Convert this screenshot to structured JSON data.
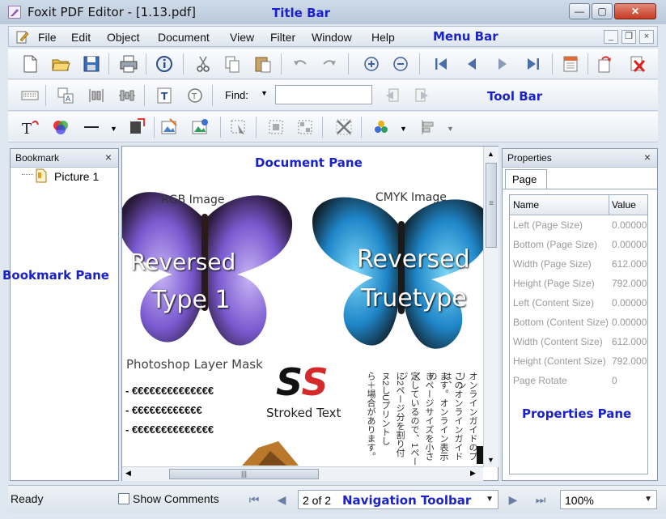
{
  "window": {
    "title": "Foxit PDF Editor - [1.13.pdf]",
    "minimize_glyph": "—",
    "maximize_glyph": "▢",
    "close_glyph": "✕"
  },
  "annotations": {
    "title_bar": "Title Bar",
    "menu_bar": "Menu Bar",
    "tool_bar": "Tool Bar",
    "document_pane": "Document Pane",
    "bookmark_pane": "Bookmark Pane",
    "properties_pane": "Properties Pane",
    "navigation_toolbar": "Navigation Toolbar"
  },
  "menu": {
    "items": [
      "File",
      "Edit",
      "Object",
      "Document",
      "View",
      "Filter",
      "Window",
      "Help"
    ],
    "mdi_minimize": "_",
    "mdi_restore": "❐",
    "mdi_close": "×"
  },
  "toolbar": {
    "find_label": "Find:",
    "find_value": "",
    "dropdown_arrow": "▼"
  },
  "bookmark_pane": {
    "title": "Bookmark",
    "close": "×",
    "items": [
      {
        "label": "Picture 1",
        "icon": "page-icon"
      }
    ]
  },
  "document": {
    "rgb_label": "RGB Image",
    "cmyk_label": "CMYK Image",
    "left_title_1": "Reversed",
    "left_title_2": "Type 1",
    "right_title_1": "Reversed",
    "right_title_2": "Truetype",
    "layer_mask": "Photoshop Layer Mask",
    "ss_text": "SS",
    "stroked_text": "Stroked Text",
    "euro_lines": [
      "- €€€€€€€€€€€€€€",
      "- €€€€€€€€€€€€",
      "- €€€€€€€€€€€€€€"
    ],
    "jp_columns": [
      "オンラインガイドのプリン",
      "このオンラインガイドは、",
      "ます。オンライン表示の",
      "きページサイズを小さく",
      "定しているので、1ページ",
      "に2ページ分を割り付",
      "ヌ2しUプリントし",
      "ら＋場合があります。"
    ],
    "hscroll_grip": "|||",
    "vscroll_grip": "≡"
  },
  "properties_pane": {
    "title": "Properties",
    "close": "×",
    "tab": "Page",
    "columns": [
      "Name",
      "Value"
    ],
    "rows": [
      {
        "name": "Left (Page Size)",
        "value": "0.00000"
      },
      {
        "name": "Bottom (Page Size)",
        "value": "0.00000"
      },
      {
        "name": "Width (Page Size)",
        "value": "612.000"
      },
      {
        "name": "Height (Page Size)",
        "value": "792.000"
      },
      {
        "name": "Left (Content Size)",
        "value": "0.00000"
      },
      {
        "name": "Bottom (Content Size)",
        "value": "0.00000"
      },
      {
        "name": "Width (Content Size)",
        "value": "612.000"
      },
      {
        "name": "Height (Content Size)",
        "value": "792.000"
      },
      {
        "name": "Page Rotate",
        "value": "0"
      }
    ]
  },
  "statusbar": {
    "status": "Ready",
    "show_comments": "Show Comments",
    "page_value": "2 of 2",
    "zoom_value": "100%",
    "arrow": "▼"
  },
  "colors": {
    "annotation": "#1a22c8",
    "title_gradient_top": "#cfdbe8",
    "close_button": "#c33a22"
  }
}
